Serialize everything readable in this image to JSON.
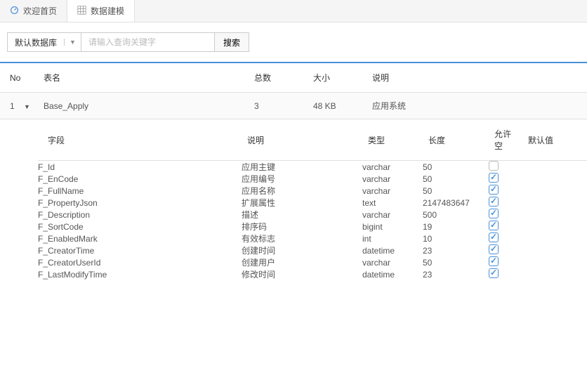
{
  "tabs": [
    {
      "label": "欢迎首页",
      "icon": "dashboard"
    },
    {
      "label": "数据建模",
      "icon": "grid"
    }
  ],
  "toolbar": {
    "db_label": "默认数据库",
    "search_placeholder": "请输入查询关键字",
    "search_btn": "搜索"
  },
  "outer_headers": {
    "no": "No",
    "name": "表名",
    "total": "总数",
    "size": "大小",
    "desc": "说明"
  },
  "outer_row": {
    "no": "1",
    "name": "Base_Apply",
    "total": "3",
    "size": "48 KB",
    "desc": "应用系统"
  },
  "inner_headers": {
    "field": "字段",
    "desc": "说明",
    "type": "类型",
    "len": "长度",
    "null": "允许空",
    "def": "默认值"
  },
  "fields": [
    {
      "field": "F_Id",
      "desc": "应用主键",
      "type": "varchar",
      "len": "50",
      "null": false
    },
    {
      "field": "F_EnCode",
      "desc": "应用编号",
      "type": "varchar",
      "len": "50",
      "null": true
    },
    {
      "field": "F_FullName",
      "desc": "应用名称",
      "type": "varchar",
      "len": "50",
      "null": true
    },
    {
      "field": "F_PropertyJson",
      "desc": "扩展属性",
      "type": "text",
      "len": "2147483647",
      "null": true
    },
    {
      "field": "F_Description",
      "desc": "描述",
      "type": "varchar",
      "len": "500",
      "null": true
    },
    {
      "field": "F_SortCode",
      "desc": "排序码",
      "type": "bigint",
      "len": "19",
      "null": true
    },
    {
      "field": "F_EnabledMark",
      "desc": "有效标志",
      "type": "int",
      "len": "10",
      "null": true
    },
    {
      "field": "F_CreatorTime",
      "desc": "创建时间",
      "type": "datetime",
      "len": "23",
      "null": true
    },
    {
      "field": "F_CreatorUserId",
      "desc": "创建用户",
      "type": "varchar",
      "len": "50",
      "null": true
    },
    {
      "field": "F_LastModifyTime",
      "desc": "修改时间",
      "type": "datetime",
      "len": "23",
      "null": true
    }
  ]
}
